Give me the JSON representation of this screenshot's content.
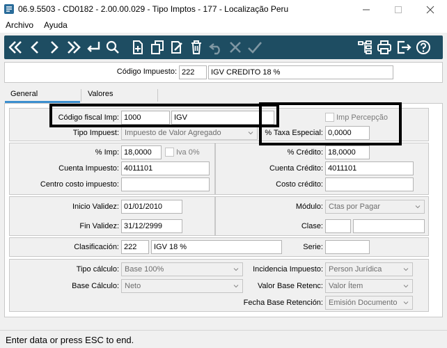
{
  "window": {
    "title": "06.9.5503 - CD0182 - 2.00.00.029 - Tipo Imptos - 177 - Localização Peru"
  },
  "menu": {
    "archivo": "Archivo",
    "ayuda": "Ayuda"
  },
  "header": {
    "codigo_label": "Código Impuesto:",
    "codigo_value": "222",
    "descripcion_value": "IGV CREDITO 18 %"
  },
  "tabs": {
    "general": "General",
    "valores": "Valores"
  },
  "general": {
    "codigo_fiscal_label": "Código fiscal Imp:",
    "codigo_fiscal_value": "1000",
    "codigo_fiscal_desc": "IGV",
    "imp_percepcion_label": "Imp Percepção",
    "tipo_impuest_label": "Tipo Impuest:",
    "tipo_impuest_value": "Impuesto de Valor Agregado",
    "taxa_especial_label": "% Taxa Especial:",
    "taxa_especial_value": "0,0000",
    "imp_label": "% Imp:",
    "imp_value": "18,0000",
    "iva_label": "Iva 0%",
    "credito_label": "% Crédito:",
    "credito_value": "18,0000",
    "cuenta_impuesto_label": "Cuenta Impuesto:",
    "cuenta_impuesto_value": "4011101",
    "cuenta_credito_label": "Cuenta Crédito:",
    "cuenta_credito_value": "4011101",
    "centro_costo_label": "Centro costo impuesto:",
    "centro_costo_value": "",
    "costo_credito_label": "Costo crédito:",
    "costo_credito_value": "",
    "inicio_validez_label": "Inicio Validez:",
    "inicio_validez_value": "01/01/2010",
    "fin_validez_label": "Fin Validez:",
    "fin_validez_value": "31/12/2999",
    "modulo_label": "Módulo:",
    "modulo_value": "Ctas por Pagar",
    "clase_label": "Clase:",
    "clase_value": "",
    "clase_desc": "",
    "clasificacion_label": "Clasificación:",
    "clasificacion_value": "222",
    "clasificacion_desc": "IGV 18 %",
    "serie_label": "Serie:",
    "serie_value": "",
    "tipo_calculo_label": "Tipo cálculo:",
    "tipo_calculo_value": "Base 100%",
    "incidencia_label": "Incidencia Impuesto:",
    "incidencia_value": "Person Jurídica",
    "base_calculo_label": "Base Cálculo:",
    "base_calculo_value": "Neto",
    "valor_base_label": "Valor Base Retenc:",
    "valor_base_value": "Valor Ítem",
    "fecha_base_label": "Fecha Base Retención:",
    "fecha_base_value": "Emisión Documento"
  },
  "status": {
    "text": "Enter data or press ESC to end."
  },
  "colors": {
    "toolbar": "#1e4d62",
    "tab_accent": "#3c8fcf",
    "highlight": "#000000"
  }
}
